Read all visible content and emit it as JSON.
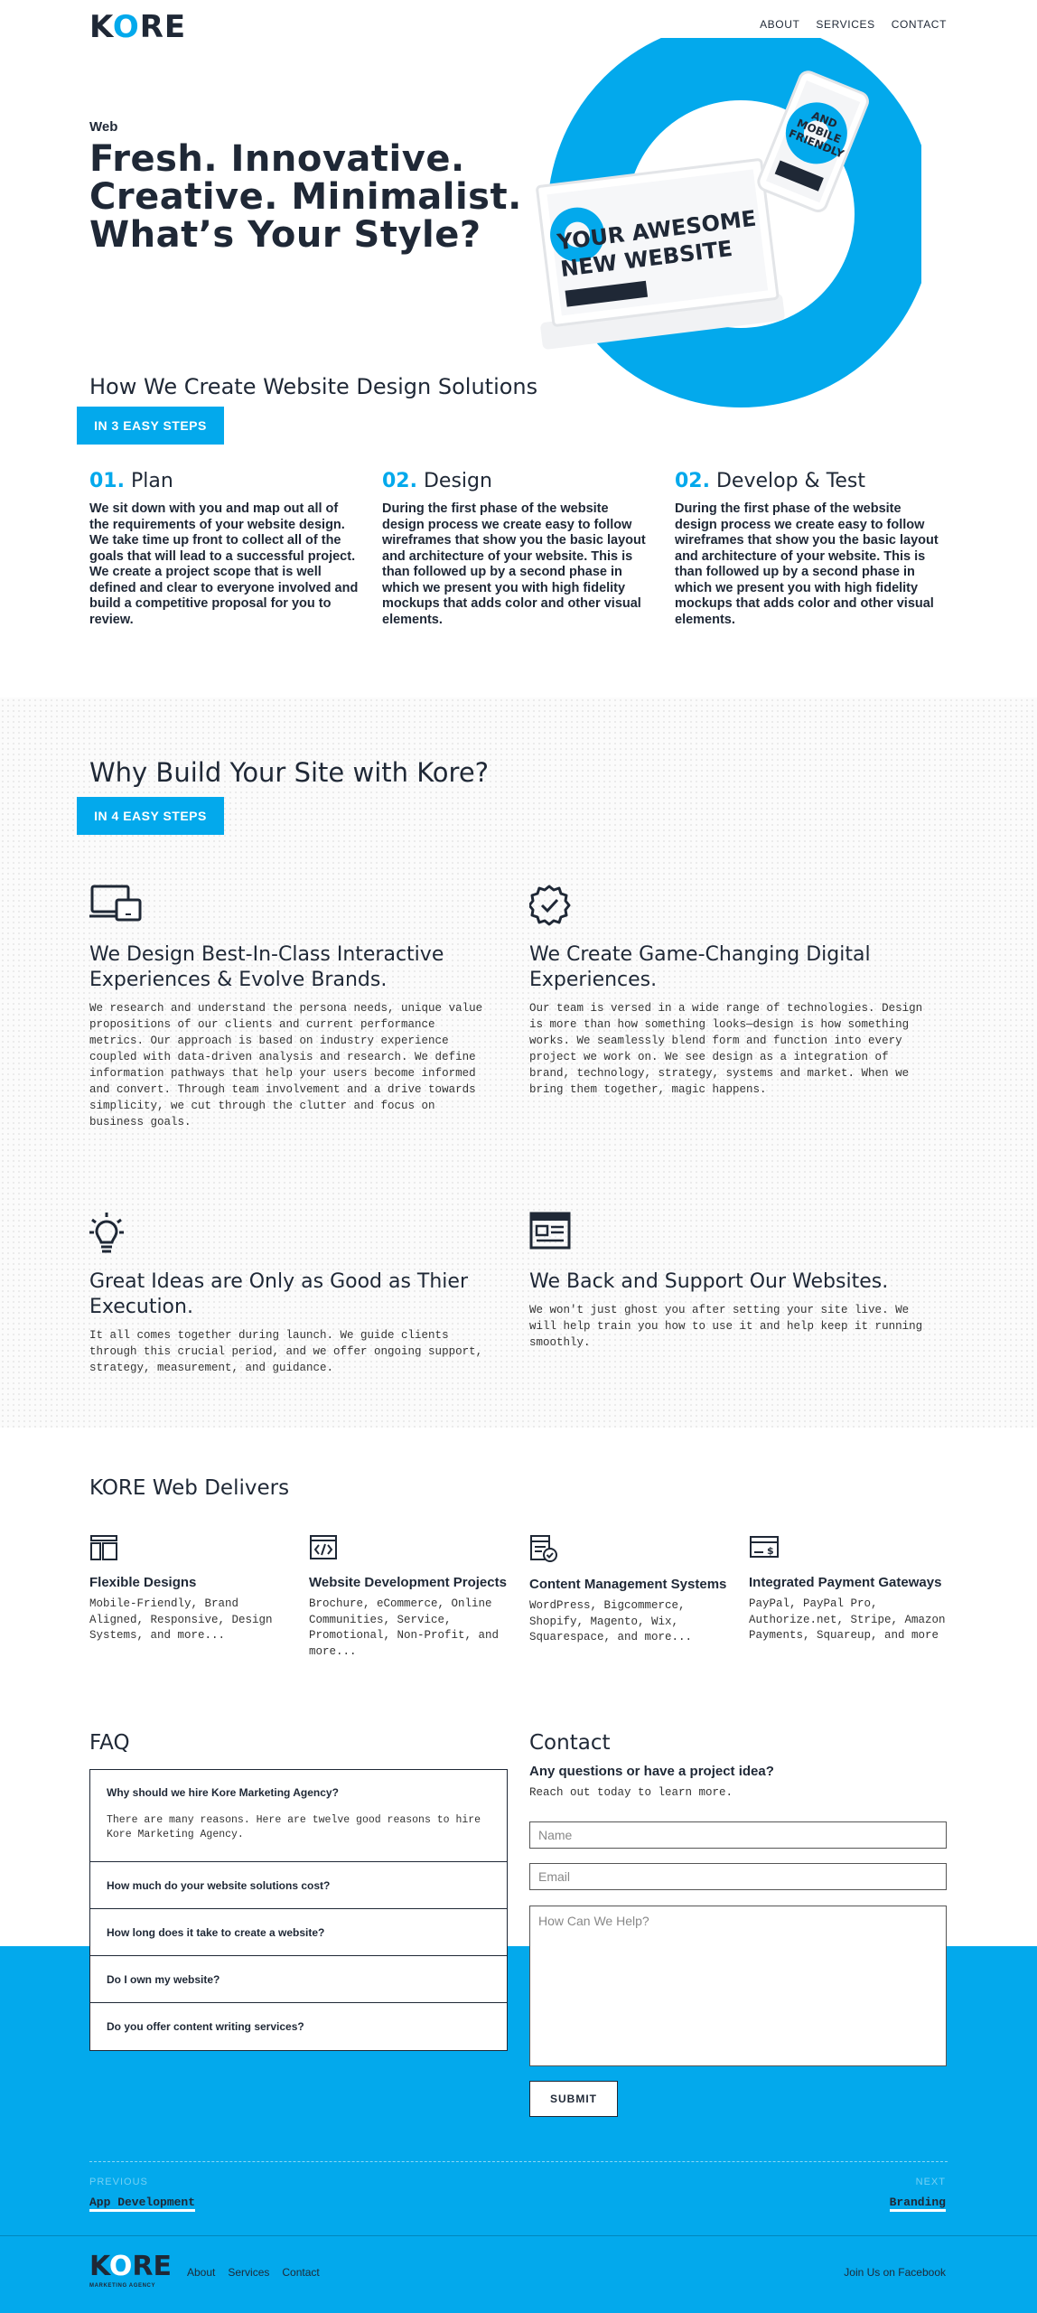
{
  "header": {
    "logo_pre": "K",
    "logo_o": "O",
    "logo_post": "RE",
    "nav": [
      "ABOUT",
      "SERVICES",
      "CONTACT"
    ]
  },
  "hero": {
    "kicker": "Web",
    "title_lines": [
      "Fresh. Innovative.",
      "Creative. Minimalist.",
      "What’s Your Style?"
    ],
    "art_text_1": "YOUR AWESOME",
    "art_text_2": "NEW WEBSITE",
    "phone_text_1": "AND",
    "phone_text_2": "MOBILE",
    "phone_text_3": "FRIENDLY"
  },
  "how": {
    "heading": "How We Create Website Design Solutions",
    "badge": "IN 3 EASY STEPS",
    "steps": [
      {
        "num": "01.",
        "title": "Plan",
        "text": "We sit down with you and map out all of the requirements of your website design. We take time up front to collect all of the goals that will lead to a successful project. We create a project scope that is well defined and clear to everyone involved and build a competitive proposal for you to review."
      },
      {
        "num": "02.",
        "title": "Design",
        "text": "During the first phase of the website design process we create easy to follow wireframes that show you the basic layout and architecture of your website. This is than followed up by a second phase in which we present you with high fidelity mockups that adds color and other visual elements."
      },
      {
        "num": "02.",
        "title": "Develop & Test",
        "text": "During the first phase of the website design process we create easy to follow wireframes that show you the basic layout and architecture of your website. This is than followed up by a second phase in which we present you with high fidelity mockups that adds color and other visual elements."
      }
    ]
  },
  "why": {
    "heading": "Why Build Your Site with Kore?",
    "badge": "IN 4 EASY STEPS",
    "items": [
      {
        "icon": "devices-icon",
        "title": "We Design Best-In-Class Interactive Experiences & Evolve Brands.",
        "text": "We research and understand the persona needs, unique value propositions of our clients and current performance metrics. Our approach is based on industry experience coupled with data-driven analysis and research. We define information pathways that help your users become informed and convert. Through team involvement and a drive towards simplicity, we cut through the clutter and focus on business goals."
      },
      {
        "icon": "badge-check-icon",
        "title": "We Create Game-Changing Digital Experiences.",
        "text": "Our team is versed in a wide range of technologies. Design is more than how something looks—design is how something works. We seamlessly blend form and function into every project we work on. We see design as a integration of brand, technology, strategy, systems and market. When we bring them together, magic happens."
      },
      {
        "icon": "lightbulb-icon",
        "title": "Great Ideas are Only as Good as Thier Execution.",
        "text": "It all comes together during launch. We guide clients through this crucial period, and we offer ongoing support, strategy, measurement, and guidance."
      },
      {
        "icon": "browser-window-icon",
        "title": "We Back and Support Our Websites.",
        "text": "We won't just ghost you after setting your site live. We will help train you how to use it and help keep it running smoothly."
      }
    ]
  },
  "delivers": {
    "heading": "KORE Web Delivers",
    "items": [
      {
        "icon": "layout-icon",
        "title": "Flexible Designs",
        "text": "Mobile-Friendly, Brand Aligned, Responsive, Design Systems, and more..."
      },
      {
        "icon": "code-icon",
        "title": "Website Development Projects",
        "text": "Brochure, eCommerce, Online Communities, Service, Promotional, Non-Profit, and more..."
      },
      {
        "icon": "cms-icon",
        "title": "Content Management Systems",
        "text": "WordPress, Bigcommerce, Shopify, Magento, Wix, Squarespace, and more..."
      },
      {
        "icon": "payment-icon",
        "title": "Integrated Payment Gateways",
        "text": "PayPal, PayPal Pro, Authorize.net, Stripe, Amazon Payments, Squareup, and more"
      }
    ]
  },
  "faq": {
    "heading": "FAQ",
    "items": [
      {
        "q": "Why should we hire Kore Marketing Agency?",
        "a": "There are many reasons. Here are twelve good reasons to hire Kore Marketing Agency."
      },
      {
        "q": "How much do your website solutions cost?"
      },
      {
        "q": "How long does it take to create a website?"
      },
      {
        "q": "Do I own my website?"
      },
      {
        "q": "Do you offer content writing services?"
      }
    ]
  },
  "contact": {
    "heading": "Contact",
    "subheading": "Any questions or have a project idea?",
    "text": "Reach out today to learn more.",
    "name_placeholder": "Name",
    "email_placeholder": "Email",
    "message_placeholder": "How Can We Help?",
    "submit": "SUBMIT"
  },
  "pager": {
    "prev_label": "PREVIOUS",
    "prev_link": "App Development",
    "next_label": "NEXT",
    "next_link": "Branding"
  },
  "footer": {
    "logo_pre": "K",
    "logo_o": "O",
    "logo_post": "RE",
    "tagline": "MARKETING AGENCY",
    "nav": [
      "About",
      "Services",
      "Contact"
    ],
    "facebook": "Join Us on Facebook"
  },
  "colors": {
    "accent": "#03a9ec",
    "text": "#1f2836"
  }
}
